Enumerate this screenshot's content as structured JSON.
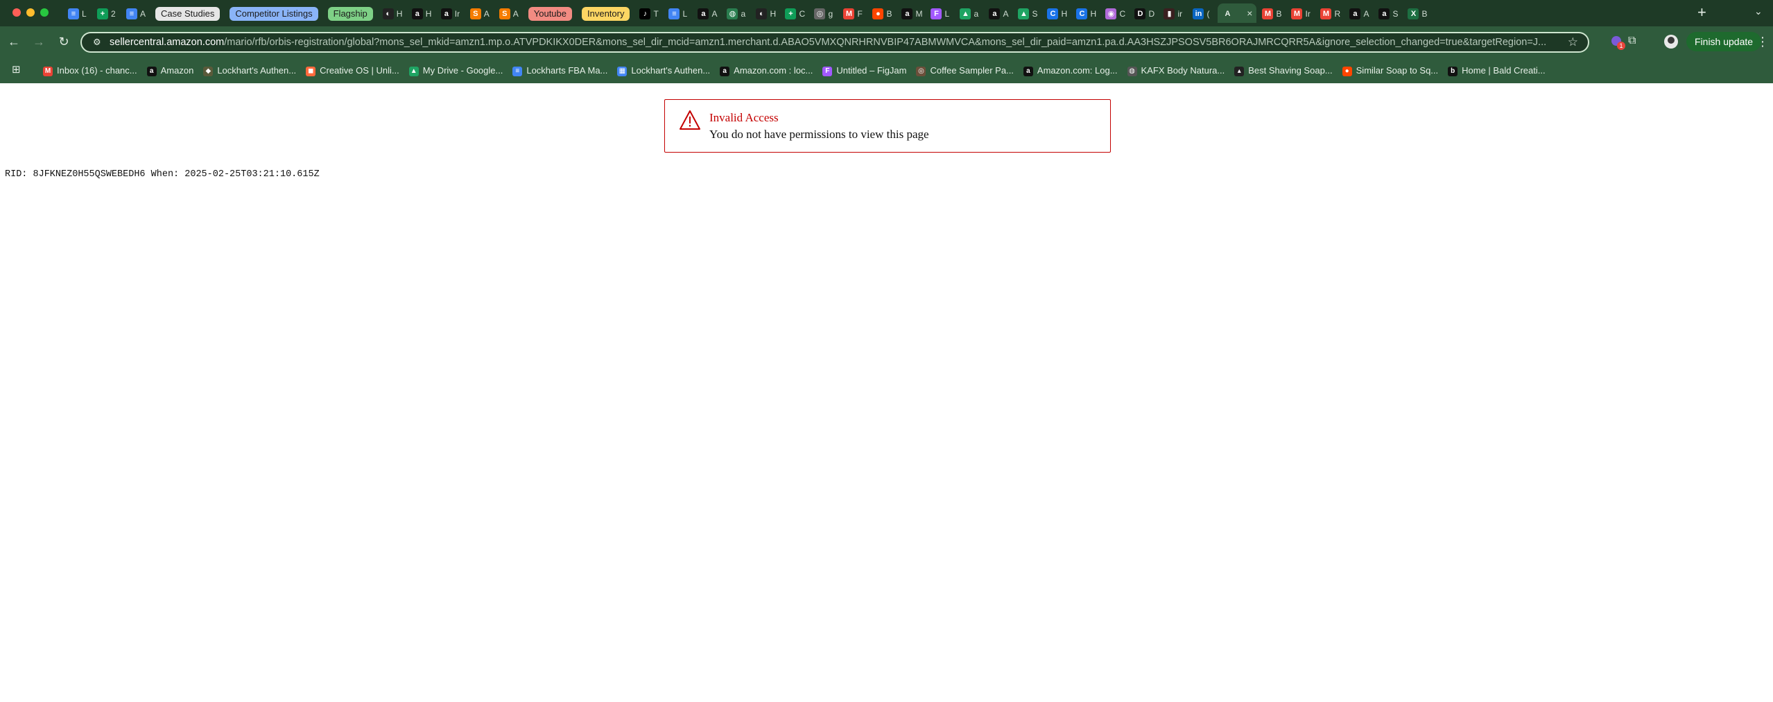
{
  "browser": {
    "tab_groups": [
      {
        "label": "Case Studies",
        "color": "#e6e6e6"
      },
      {
        "label": "Competitor Listings",
        "color": "#8ab4f8"
      },
      {
        "label": "Flagship",
        "color": "#7ed086"
      },
      {
        "label": "Youtube",
        "color": "#f28b82"
      },
      {
        "label": "Inventory",
        "color": "#fdd663"
      }
    ],
    "tabs": [
      {
        "fav": "docs-icon",
        "glyph": "≡",
        "bg": "#4285f4",
        "title": "L"
      },
      {
        "fav": "sheets-icon",
        "glyph": "+",
        "bg": "#0f9d58",
        "title": "2"
      },
      {
        "fav": "docs-icon",
        "glyph": "≡",
        "bg": "#4285f4",
        "title": "A"
      },
      {
        "fav": "dark-logo-icon",
        "glyph": "◐",
        "bg": "#222222",
        "title": "H"
      },
      {
        "fav": "amazon-icon",
        "glyph": "a",
        "bg": "#111111",
        "title": "H"
      },
      {
        "fav": "amazon-icon",
        "glyph": "a",
        "bg": "#111111",
        "title": "Ir"
      },
      {
        "fav": "s-logo-icon",
        "glyph": "S",
        "bg": "#f57c00",
        "title": "A"
      },
      {
        "fav": "s-logo-icon",
        "glyph": "S",
        "bg": "#f57c00",
        "title": "A"
      },
      {
        "fav": "tiktok-icon",
        "glyph": "♪",
        "bg": "#000000",
        "title": "T"
      },
      {
        "fav": "docs-icon",
        "glyph": "≡",
        "bg": "#4285f4",
        "title": "L"
      },
      {
        "fav": "amazon-icon",
        "glyph": "a",
        "bg": "#111111",
        "title": "A"
      },
      {
        "fav": "globe-icon",
        "glyph": "◍",
        "bg": "#2a7d4f",
        "title": "a"
      },
      {
        "fav": "dark-logo-icon",
        "glyph": "◐",
        "bg": "#222222",
        "title": "H"
      },
      {
        "fav": "sheets-icon",
        "glyph": "+",
        "bg": "#0f9d58",
        "title": "C"
      },
      {
        "fav": "generic-icon",
        "glyph": "◎",
        "bg": "#666666",
        "title": "g"
      },
      {
        "fav": "gmail-icon",
        "glyph": "M",
        "bg": "#ea4335",
        "title": "F"
      },
      {
        "fav": "reddit-icon",
        "glyph": "●",
        "bg": "#ff4500",
        "title": "B"
      },
      {
        "fav": "amazon-icon",
        "glyph": "a",
        "bg": "#111111",
        "title": "M"
      },
      {
        "fav": "figma-icon",
        "glyph": "F",
        "bg": "#a259ff",
        "title": "L"
      },
      {
        "fav": "drive-icon",
        "glyph": "▲",
        "bg": "#1fa463",
        "title": "a"
      },
      {
        "fav": "amazon-icon",
        "glyph": "a",
        "bg": "#111111",
        "title": "A"
      },
      {
        "fav": "drive-icon",
        "glyph": "▲",
        "bg": "#1fa463",
        "title": "S"
      },
      {
        "fav": "chrome-icon",
        "glyph": "C",
        "bg": "#1a73e8",
        "title": "H"
      },
      {
        "fav": "chrome-icon",
        "glyph": "C",
        "bg": "#1a73e8",
        "title": "H"
      },
      {
        "fav": "canva-icon",
        "glyph": "◉",
        "bg": "#b06ad9",
        "title": "C"
      },
      {
        "fav": "d-logo-icon",
        "glyph": "D",
        "bg": "#111111",
        "title": "D"
      },
      {
        "fav": "dark-logo-icon",
        "glyph": "▮",
        "bg": "#3a2020",
        "title": "ir"
      },
      {
        "fav": "linkedin-icon",
        "glyph": "in",
        "bg": "#0a66c2",
        "title": "("
      },
      {
        "fav": "gmail-icon",
        "glyph": "M",
        "bg": "#ea4335",
        "title": "B"
      },
      {
        "fav": "gmail-icon",
        "glyph": "M",
        "bg": "#ea4335",
        "title": "Ir"
      },
      {
        "fav": "gmail-icon",
        "glyph": "M",
        "bg": "#ea4335",
        "title": "R"
      },
      {
        "fav": "amazon-icon",
        "glyph": "a",
        "bg": "#111111",
        "title": "A"
      },
      {
        "fav": "amazon-icon",
        "glyph": "a",
        "bg": "#111111",
        "title": "S"
      },
      {
        "fav": "excel-icon",
        "glyph": "X",
        "bg": "#1d6f42",
        "title": "B"
      }
    ],
    "active_tab_title": "A",
    "url_host": "sellercentral.amazon.com",
    "url_rest": "/mario/rfb/orbis-registration/global?mons_sel_mkid=amzn1.mp.o.ATVPDKIKX0DER&mons_sel_dir_mcid=amzn1.merchant.d.ABAO5VMXQNRHRNVBIP47ABMWMVCA&mons_sel_dir_paid=amzn1.pa.d.AA3HSZJPSOSV5BR6ORAJMRCQRR5A&ignore_selection_changed=true&targetRegion=J...",
    "extension_badge": "1",
    "finish_update_label": "Finish update",
    "bookmarks": [
      {
        "label": "Inbox (16) - chanc...",
        "fav": "gmail-icon",
        "glyph": "M",
        "bg": "#ea4335"
      },
      {
        "label": "Amazon",
        "fav": "amazon-icon",
        "glyph": "a",
        "bg": "#111111"
      },
      {
        "label": "Lockhart's Authen...",
        "fav": "lockhart-icon",
        "glyph": "◆",
        "bg": "#5a5a3a"
      },
      {
        "label": "Creative OS | Unli...",
        "fav": "creative-os-icon",
        "glyph": "◼",
        "bg": "#ff6a3d"
      },
      {
        "label": "My Drive - Google...",
        "fav": "drive-icon",
        "glyph": "▲",
        "bg": "#1fa463"
      },
      {
        "label": "Lockharts FBA Ma...",
        "fav": "docs-icon",
        "glyph": "≡",
        "bg": "#4285f4"
      },
      {
        "label": "Lockhart's Authen...",
        "fav": "calendar-icon",
        "glyph": "▦",
        "bg": "#4285f4"
      },
      {
        "label": "Amazon.com : loc...",
        "fav": "amazon-icon",
        "glyph": "a",
        "bg": "#111111"
      },
      {
        "label": "Untitled – FigJam",
        "fav": "figma-icon",
        "glyph": "F",
        "bg": "#a259ff"
      },
      {
        "label": "Coffee Sampler Pa...",
        "fav": "coffee-icon",
        "glyph": "◎",
        "bg": "#6b4f3a"
      },
      {
        "label": "Amazon.com: Log...",
        "fav": "amazon-icon",
        "glyph": "a",
        "bg": "#111111"
      },
      {
        "label": "KAFX Body Natura...",
        "fav": "globe-icon",
        "glyph": "◍",
        "bg": "#555555"
      },
      {
        "label": "Best Shaving Soap...",
        "fav": "shaving-icon",
        "glyph": "▴",
        "bg": "#222222"
      },
      {
        "label": "Similar Soap to Sq...",
        "fav": "reddit-icon",
        "glyph": "●",
        "bg": "#ff4500"
      },
      {
        "label": "Home | Bald Creati...",
        "fav": "b-logo-icon",
        "glyph": "b",
        "bg": "#111111"
      }
    ]
  },
  "page": {
    "alert_heading": "Invalid Access",
    "alert_message": "You do not have permissions to view this page",
    "rid_text": "RID: 8JFKNEZ0H55QSWEBEDH6 When: 2025-02-25T03:21:10.615Z",
    "alert_color": "#c40000"
  }
}
